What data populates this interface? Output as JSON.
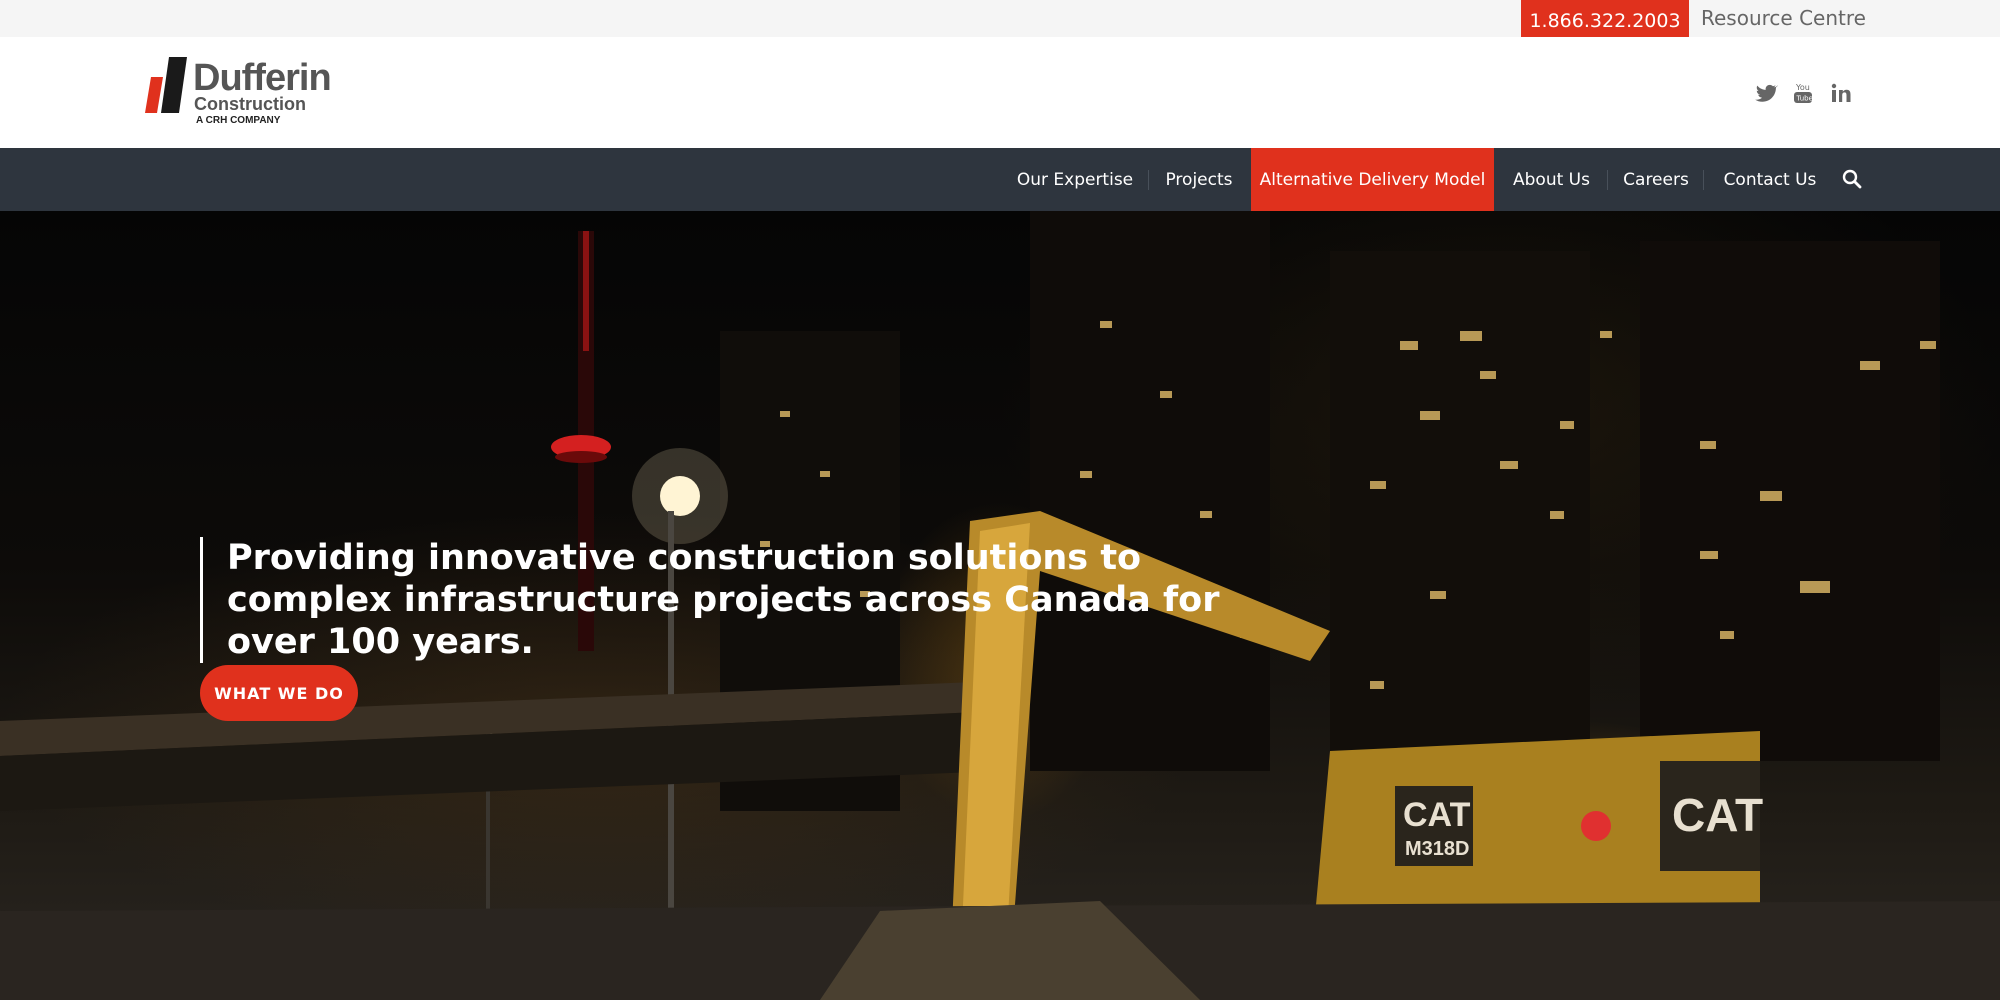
{
  "topbar": {
    "phone": "1.866.322.2003",
    "resource_centre": "Resource Centre"
  },
  "logo": {
    "name": "Dufferin",
    "sub": "Construction",
    "tagline": "A CRH COMPANY"
  },
  "social": [
    "twitter-icon",
    "youtube-icon",
    "linkedin-icon"
  ],
  "nav": {
    "items": [
      {
        "label": "Our Expertise"
      },
      {
        "label": "Projects"
      },
      {
        "label": "Alternative Delivery Model",
        "active": true
      },
      {
        "label": "About Us"
      },
      {
        "label": "Careers"
      },
      {
        "label": "Contact Us"
      }
    ],
    "search_icon": "search-icon"
  },
  "hero": {
    "headline": "Providing innovative construction solutions to complex infrastructure projects across Canada for over 100 years.",
    "cta_label": "WHAT WE DO"
  },
  "colors": {
    "accent": "#e0311d",
    "nav_bg": "#2e353e",
    "topbar_bg": "#f5f5f5"
  }
}
